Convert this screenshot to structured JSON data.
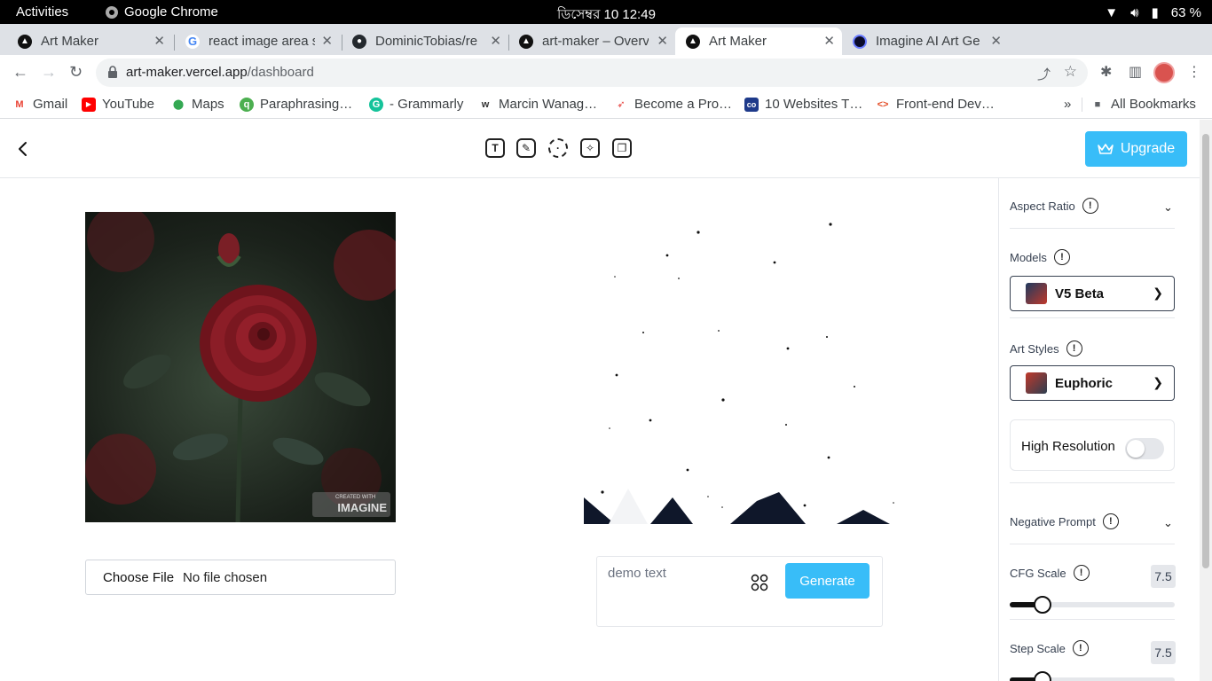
{
  "os": {
    "activities": "Activities",
    "app_name": "Google Chrome",
    "clock": "ডিসেম্বর 10  12:49",
    "battery": "63 %"
  },
  "tabs": [
    {
      "title": "Art Maker",
      "active": false
    },
    {
      "title": "react image area s",
      "active": false
    },
    {
      "title": "DominicTobias/re",
      "active": false
    },
    {
      "title": "art-maker – Overv",
      "active": false
    },
    {
      "title": "Art Maker",
      "active": true
    },
    {
      "title": "Imagine AI Art Ge",
      "active": false
    }
  ],
  "address_bar": {
    "host": "art-maker.vercel.app",
    "path": "/dashboard"
  },
  "bookmarks": [
    {
      "label": "Gmail",
      "icon": "gmail-icon",
      "color": "#ea4335"
    },
    {
      "label": "YouTube",
      "icon": "youtube-icon",
      "color": "#ff0000"
    },
    {
      "label": "Maps",
      "icon": "maps-icon",
      "color": "#34a853"
    },
    {
      "label": "Paraphrasing…",
      "icon": "quillbot-icon",
      "color": "#4caf50"
    },
    {
      "label": "- Grammarly",
      "icon": "grammarly-icon",
      "color": "#15c39a"
    },
    {
      "label": "Marcin Wanag…",
      "icon": "w-icon",
      "color": "#333333"
    },
    {
      "label": "Become a Pro…",
      "icon": "rocket-icon",
      "color": "#e53935"
    },
    {
      "label": "10 Websites T…",
      "icon": "co-icon",
      "color": "#1e3a8a"
    },
    {
      "label": "Front-end Dev…",
      "icon": "code-icon",
      "color": "#e44d26"
    }
  ],
  "bookmarks_folder": "All Bookmarks",
  "app": {
    "upgrade_label": "Upgrade",
    "file_choose": "Choose File",
    "file_status": "No file chosen",
    "watermark_small": "CREATED WITH",
    "watermark_big": "IMAGINE",
    "prompt_text": "demo text",
    "generate_label": "Generate",
    "accent_color": "#38bdf8"
  },
  "sidebar": {
    "aspect_ratio_label": "Aspect Ratio",
    "models_label": "Models",
    "model_value": "V5 Beta",
    "art_styles_label": "Art Styles",
    "art_style_value": "Euphoric",
    "high_resolution_label": "High Resolution",
    "high_resolution_on": false,
    "negative_prompt_label": "Negative Prompt",
    "cfg_scale_label": "CFG Scale",
    "cfg_scale_value": "7.5",
    "step_scale_label": "Step Scale",
    "step_scale_value": "7.5"
  }
}
